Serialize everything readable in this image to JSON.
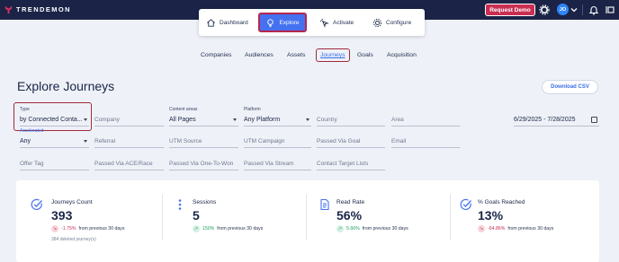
{
  "brand": {
    "logo_text": "TRENDEMON"
  },
  "topbar": {
    "request_demo": "Request Demo",
    "avatar_initials": "JO"
  },
  "main_nav": {
    "items": [
      {
        "label": "Dashboard",
        "icon": "home-icon"
      },
      {
        "label": "Explore",
        "icon": "bulb-icon",
        "active": true
      },
      {
        "label": "Activate",
        "icon": "click-icon"
      },
      {
        "label": "Configure",
        "icon": "gear-icon"
      }
    ]
  },
  "sub_nav": {
    "items": [
      "Companies",
      "Audiences",
      "Assets",
      "Journeys",
      "Goals",
      "Acquisition"
    ],
    "active": "Journeys"
  },
  "page": {
    "title": "Explore Journeys",
    "download_label": "Download CSV"
  },
  "filters": {
    "type": {
      "label": "Type",
      "value": "by Connected Conta..."
    },
    "company": {
      "placeholder": "Company"
    },
    "content_areas": {
      "label": "Content areas",
      "value": "All Pages"
    },
    "platform": {
      "label": "Platform",
      "value": "Any Platform"
    },
    "country": {
      "placeholder": "Country"
    },
    "area": {
      "placeholder": "Area"
    },
    "date_range": {
      "value": "6/29/2025 - 7/28/2025"
    },
    "accelerated": {
      "label": "Accelerated",
      "value": "Any"
    },
    "referral": {
      "placeholder": "Referral"
    },
    "utm_source": {
      "placeholder": "UTM Source"
    },
    "utm_campaign": {
      "placeholder": "UTM Campaign"
    },
    "passed_via_goal": {
      "placeholder": "Passed Via Goal"
    },
    "email": {
      "placeholder": "Email"
    },
    "offer_tag": {
      "placeholder": "Offer Tag"
    },
    "passed_via_ace": {
      "placeholder": "Passed Via ACE/Race"
    },
    "passed_via_one_to_won": {
      "placeholder": "Passed Via One-To-Won"
    },
    "passed_via_stream": {
      "placeholder": "Passed Via Stream"
    },
    "contact_target_lists": {
      "placeholder": "Contact Target Lists"
    }
  },
  "metrics": [
    {
      "label": "Journeys Count",
      "value": "393",
      "delta": "-1.75%",
      "direction": "down",
      "delta_suffix": "from previous 30 days",
      "note": "384 deleted journey(s)",
      "icon": "check-circle-icon"
    },
    {
      "label": "Sessions",
      "value": "5",
      "delta": "150%",
      "direction": "up",
      "delta_suffix": "from previous 30 days",
      "icon": "dots-vertical-icon"
    },
    {
      "label": "Read Rate",
      "value": "56%",
      "delta": "5.66%",
      "direction": "up",
      "delta_suffix": "from previous 30 days",
      "icon": "document-icon"
    },
    {
      "label": "% Goals Reached",
      "value": "13%",
      "delta": "-64.86%",
      "direction": "down",
      "delta_suffix": "from previous 30 days",
      "icon": "check-circle-icon"
    }
  ],
  "colors": {
    "accent": "#4571f0",
    "brand_red": "#c92e53",
    "topbar": "#1b2447",
    "highlight": "#a12a3a",
    "up": "#1e9f5e"
  }
}
